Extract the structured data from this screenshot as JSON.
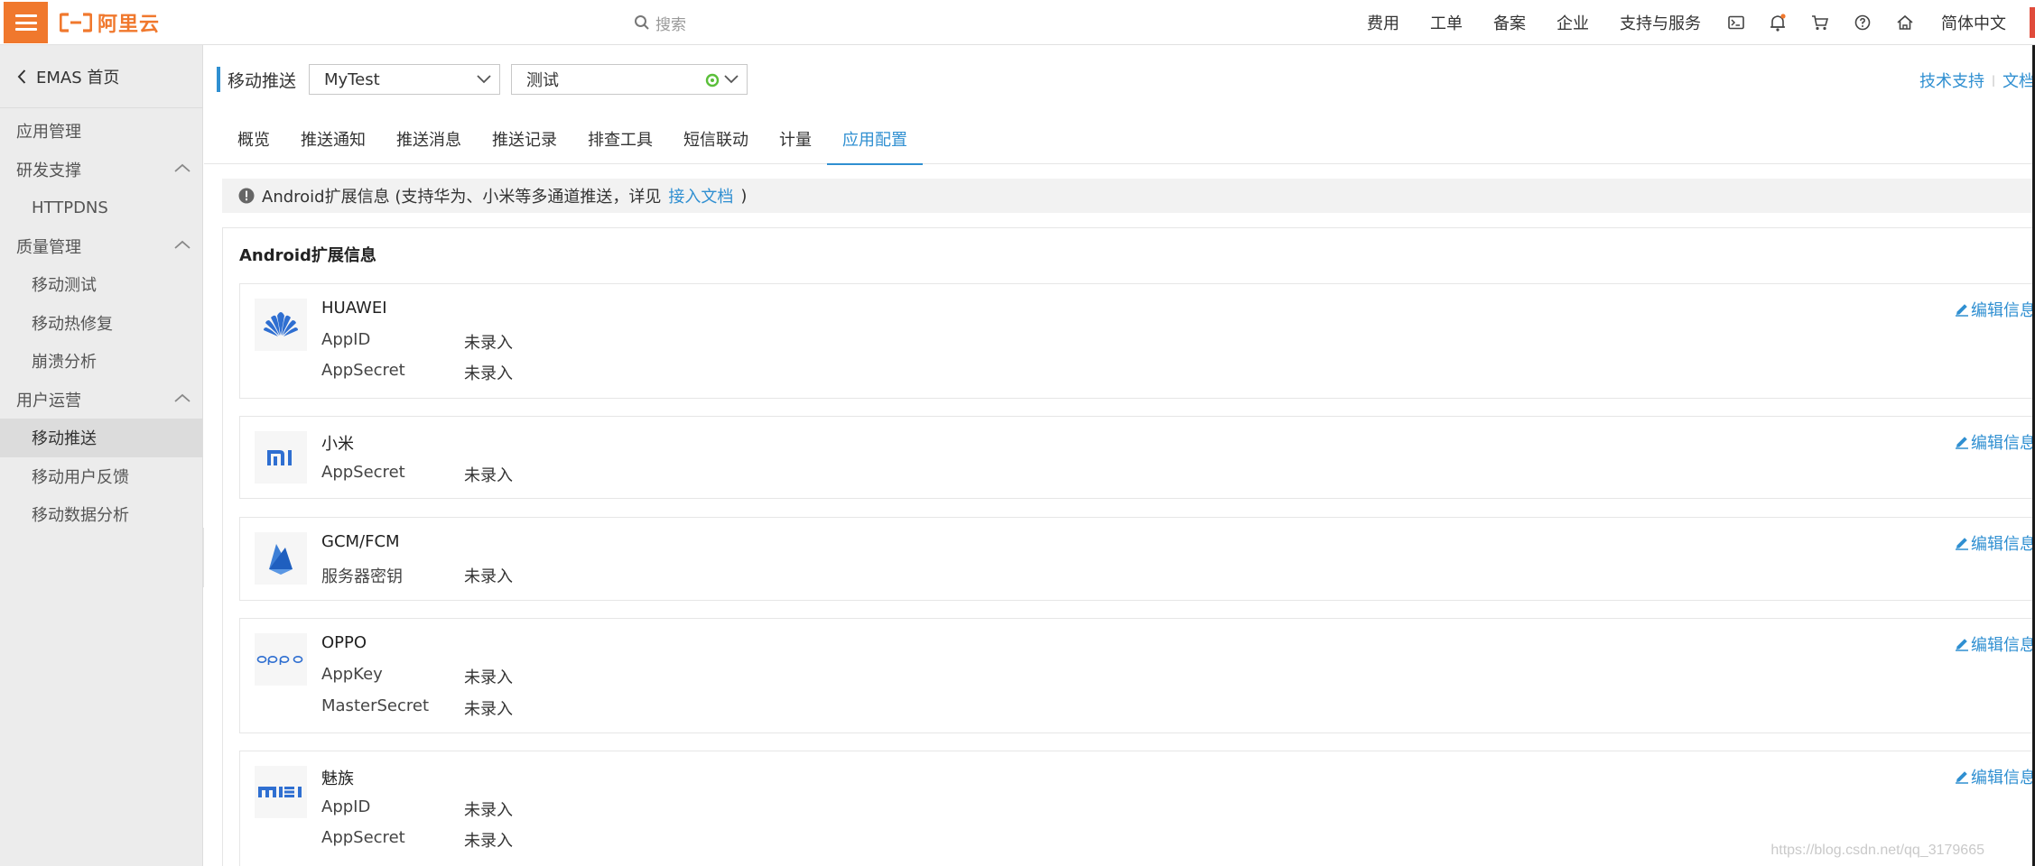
{
  "topbar": {
    "logo_text": "阿里云",
    "search_placeholder": "搜索",
    "links": [
      "费用",
      "工单",
      "备案",
      "企业",
      "支持与服务"
    ],
    "language": "简体中文",
    "accent_color": "#f0782d"
  },
  "sidebar": {
    "home_label": "EMAS 首页",
    "items": [
      {
        "type": "item",
        "label": "应用管理"
      },
      {
        "type": "group",
        "label": "研发支撑"
      },
      {
        "type": "subitem",
        "label": "HTTPDNS"
      },
      {
        "type": "group",
        "label": "质量管理"
      },
      {
        "type": "subitem",
        "label": "移动测试"
      },
      {
        "type": "subitem",
        "label": "移动热修复"
      },
      {
        "type": "subitem",
        "label": "崩溃分析"
      },
      {
        "type": "group",
        "label": "用户运营"
      },
      {
        "type": "subitem",
        "label": "移动推送",
        "active": true
      },
      {
        "type": "subitem",
        "label": "移动用户反馈"
      },
      {
        "type": "subitem",
        "label": "移动数据分析"
      }
    ]
  },
  "header": {
    "title": "移动推送",
    "app_select": "MyTest",
    "env_select": "测试",
    "help_support": "技术支持",
    "help_docs": "文档"
  },
  "tabs": [
    {
      "label": "概览"
    },
    {
      "label": "推送通知"
    },
    {
      "label": "推送消息"
    },
    {
      "label": "推送记录"
    },
    {
      "label": "排查工具"
    },
    {
      "label": "短信联动"
    },
    {
      "label": "计量"
    },
    {
      "label": "应用配置",
      "active": true
    }
  ],
  "notice": {
    "text": "Android扩展信息 (支持华为、小米等多通道推送，详见",
    "link": "接入文档",
    "suffix": ")"
  },
  "panel": {
    "title": "Android扩展信息",
    "edit_label": "编辑信息",
    "cards": [
      {
        "name": "HUAWEI",
        "logo": "huawei-logo",
        "fields": [
          {
            "k": "AppID",
            "v": "未录入"
          },
          {
            "k": "AppSecret",
            "v": "未录入"
          }
        ]
      },
      {
        "name": "小米",
        "logo": "xiaomi-logo",
        "fields": [
          {
            "k": "AppSecret",
            "v": "未录入"
          }
        ]
      },
      {
        "name": "GCM/FCM",
        "logo": "firebase-logo",
        "fields": [
          {
            "k": "服务器密钥",
            "v": "未录入"
          }
        ]
      },
      {
        "name": "OPPO",
        "logo": "oppo-logo",
        "fields": [
          {
            "k": "AppKey",
            "v": "未录入"
          },
          {
            "k": "MasterSecret",
            "v": "未录入"
          }
        ]
      },
      {
        "name": "魅族",
        "logo": "meizu-logo",
        "fields": [
          {
            "k": "AppID",
            "v": "未录入"
          },
          {
            "k": "AppSecret",
            "v": "未录入"
          }
        ]
      }
    ]
  },
  "watermark": "https://blog.csdn.net/qq_3179665"
}
